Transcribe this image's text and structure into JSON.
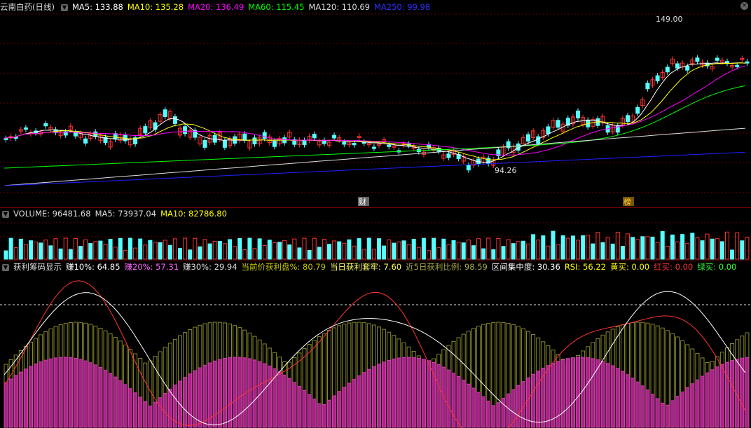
{
  "main_header": {
    "title": "云南白药(日线)",
    "ma5": "MA5: 133.88",
    "ma10": "MA10: 135.28",
    "ma20": "MA20: 136.49",
    "ma60": "MA60: 115.45",
    "ma120": "MA120: 110.69",
    "ma250": "MA250: 99.98"
  },
  "price_labels": {
    "high": "149.00",
    "low": "94.26"
  },
  "event_markers": [
    "财",
    "榜"
  ],
  "volume_header": {
    "volume": "VOLUME: 96481.68",
    "ma5": "MA5: 73937.04",
    "ma10": "MA10: 82786.80"
  },
  "indicator_header": {
    "name": "获利筹码显示",
    "earn10": "赚10%: 64.85",
    "earn20": "赚20%: 57.31",
    "earn30": "赚30%: 29.94",
    "profit_ratio": "当前价获利盘%: 80.79",
    "today_trapped": "当日获利套牢: 7.60",
    "ratio5": "近5日获利比例: 98.59",
    "concentration": "区间集中度: 30.36",
    "rsi": "RSI: 56.22",
    "yellow_buy": "黄买: 0.00",
    "red_buy": "红买: 0.00",
    "green_buy": "绿买: 0.00"
  },
  "colors": {
    "ma5": "#ffffff",
    "ma10": "#ffff00",
    "ma20": "#ff00ff",
    "ma60": "#00ff00",
    "ma120": "#dddddd",
    "ma250": "#0000ff",
    "up": "#ff3333",
    "down": "#54ffff"
  }
}
